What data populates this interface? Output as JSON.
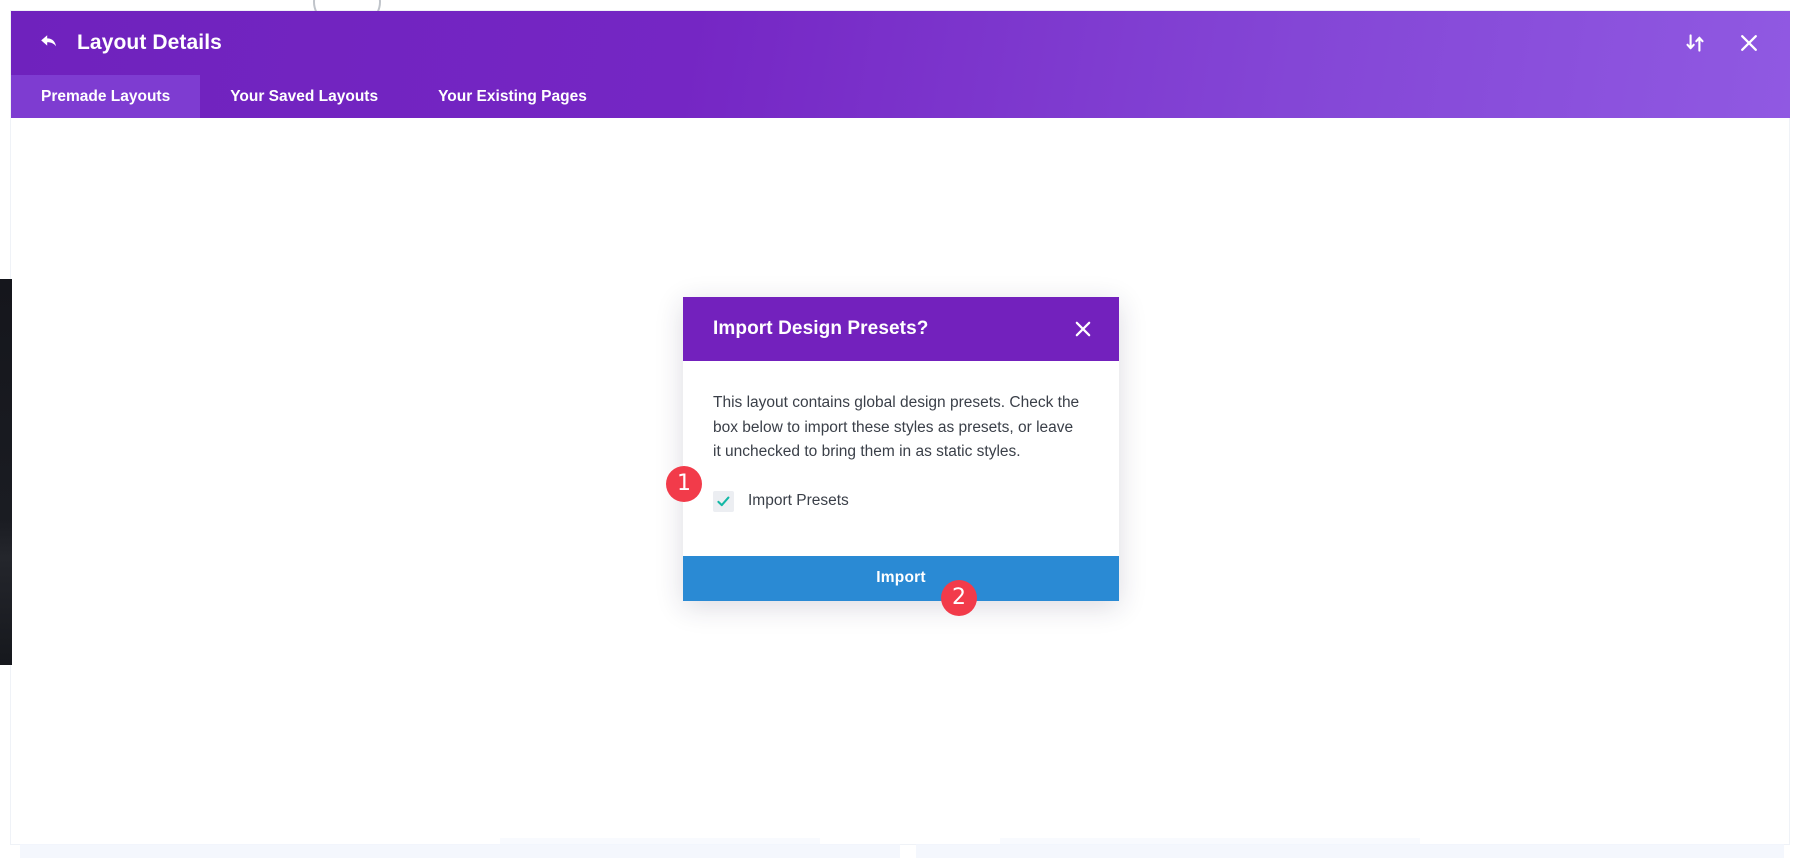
{
  "app": {
    "background_color": "#fbfcfe",
    "panel_gradient_from": "#6f22bd",
    "panel_gradient_to": "#9059e2"
  },
  "header": {
    "title": "Layout Details",
    "back_icon": "back-arrow-icon",
    "sort_icon": "sort-updown-icon",
    "close_icon": "close-icon"
  },
  "tabs": [
    {
      "label": "Premade Layouts",
      "active": true
    },
    {
      "label": "Your Saved Layouts",
      "active": false
    },
    {
      "label": "Your Existing Pages",
      "active": false
    }
  ],
  "modal": {
    "title": "Import Design Presets?",
    "close_icon": "close-icon",
    "body_text": "This layout contains global design presets. Check the box below to import these styles as presets, or leave it unchecked to bring them in as static styles.",
    "checkbox": {
      "label": "Import Presets",
      "checked": true,
      "check_glyph": "✓",
      "check_color": "#14b8a6",
      "box_color": "#eceef2"
    },
    "primary_button": {
      "label": "Import",
      "color": "#2a8ad4"
    },
    "header_color": "#7321bd"
  },
  "annotations": [
    {
      "number": "1",
      "color": "#f23b4a"
    },
    {
      "number": "2",
      "color": "#f23b4a"
    }
  ]
}
